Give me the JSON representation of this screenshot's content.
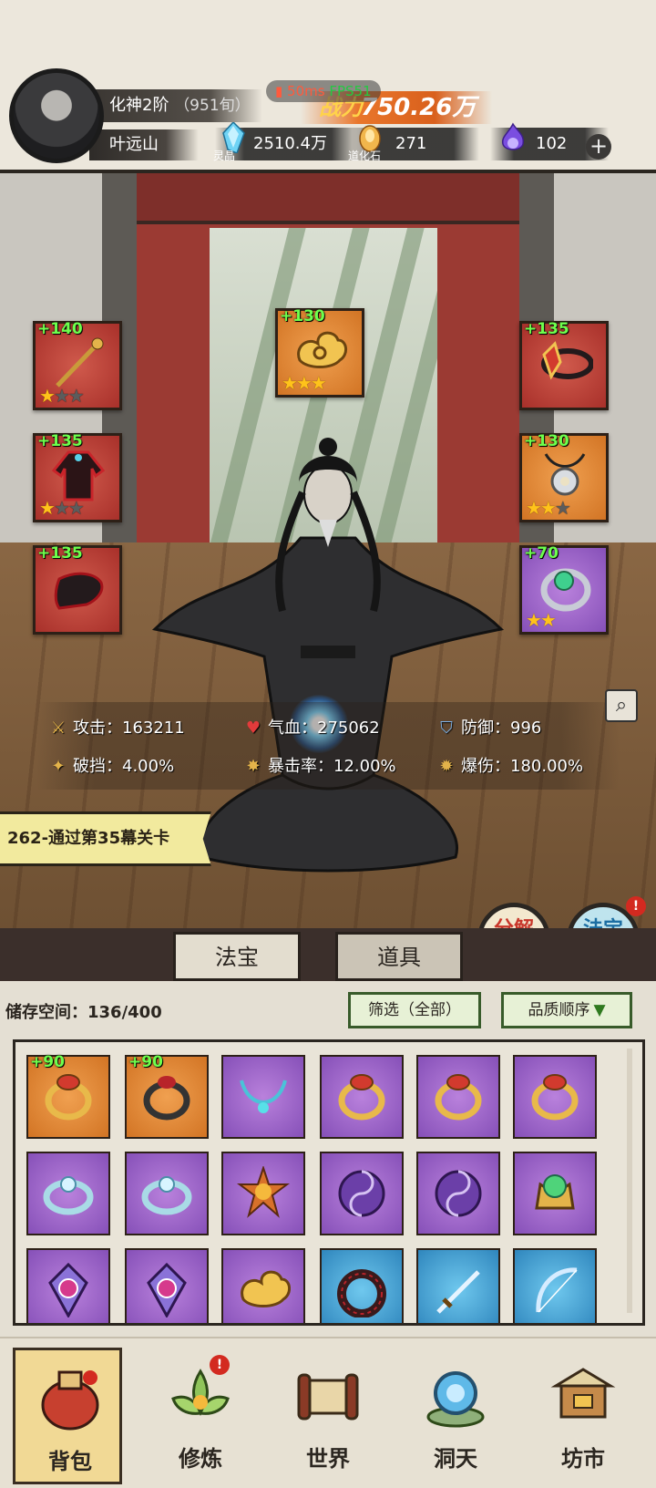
{
  "header": {
    "realm": "化神2阶",
    "realm_detail": "（951旬）",
    "player_name": "叶远山",
    "fps_ping": "50ms",
    "fps_label": "FPS51",
    "power_label": "战力",
    "power_value": "750.26万"
  },
  "currencies": [
    {
      "icon": "spirit-crystal-icon",
      "label": "灵晶",
      "value": "2510.4万"
    },
    {
      "icon": "daohua-stone-icon",
      "label": "道化石",
      "value": "271"
    },
    {
      "icon": "purple-flame-icon",
      "value": "102"
    }
  ],
  "equipped": [
    {
      "slot": "left-1",
      "level": "+140",
      "rarity": "red",
      "stars": 1,
      "icon": "staff-icon"
    },
    {
      "slot": "left-2",
      "level": "+135",
      "rarity": "red",
      "stars": 1,
      "icon": "robe-icon"
    },
    {
      "slot": "left-3",
      "level": "+135",
      "rarity": "red",
      "stars": 0,
      "icon": "boots-icon"
    },
    {
      "slot": "top",
      "level": "+130",
      "rarity": "orange",
      "stars": 3,
      "icon": "cloud-crown-icon"
    },
    {
      "slot": "right-1",
      "level": "+135",
      "rarity": "red",
      "stars": 0,
      "icon": "headband-icon"
    },
    {
      "slot": "right-2",
      "level": "+130",
      "rarity": "orange",
      "stars": 2,
      "icon": "pendant-icon"
    },
    {
      "slot": "right-3",
      "level": "+70",
      "rarity": "purple",
      "stars": 2,
      "icon": "jade-ring-icon"
    }
  ],
  "stats": {
    "attack_label": "攻击：",
    "attack_value": "163211",
    "hp_label": "气血：",
    "hp_value": "275062",
    "defense_label": "防御：",
    "defense_value": "996",
    "pierce_label": "破挡：",
    "pierce_value": "4.00%",
    "crit_label": "暴击率：",
    "crit_value": "12.00%",
    "critdmg_label": "爆伤：",
    "critdmg_value": "180.00%"
  },
  "quest": "262-通过第35幕关卡",
  "actions": {
    "decompose": "分解再造",
    "compose": "法宝合成",
    "compose_badge": "!"
  },
  "tabs": {
    "fabao": "法宝",
    "daoju": "道具"
  },
  "inventory": {
    "storage_label": "储存空间：",
    "storage_value": "136/400",
    "filter": "筛选（全部）",
    "sort": "品质顺序",
    "items": [
      {
        "rarity": "orange",
        "level": "+90",
        "icon": "gold-ring-icon"
      },
      {
        "rarity": "orange",
        "level": "+90",
        "icon": "dark-ring-icon"
      },
      {
        "rarity": "purple",
        "level": "",
        "icon": "necklace-icon"
      },
      {
        "rarity": "purple",
        "level": "",
        "icon": "gold-ring-icon"
      },
      {
        "rarity": "purple",
        "level": "",
        "icon": "gold-ring-icon"
      },
      {
        "rarity": "purple",
        "level": "",
        "icon": "gold-ring-icon"
      },
      {
        "rarity": "purple",
        "level": "",
        "icon": "silver-ring-icon"
      },
      {
        "rarity": "purple",
        "level": "",
        "icon": "silver-ring-icon"
      },
      {
        "rarity": "purple",
        "level": "",
        "icon": "sun-medallion-icon"
      },
      {
        "rarity": "purple",
        "level": "",
        "icon": "taiji-orb-icon"
      },
      {
        "rarity": "purple",
        "level": "",
        "icon": "taiji-orb-icon"
      },
      {
        "rarity": "purple",
        "level": "",
        "icon": "jade-crown-icon"
      },
      {
        "rarity": "purple",
        "level": "",
        "icon": "lotus-gem-icon"
      },
      {
        "rarity": "purple",
        "level": "",
        "icon": "lotus-gem-icon"
      },
      {
        "rarity": "purple",
        "level": "",
        "icon": "cloud-crown-icon"
      },
      {
        "rarity": "blue",
        "level": "",
        "icon": "dark-wreath-icon"
      },
      {
        "rarity": "blue",
        "level": "",
        "icon": "sword-icon"
      },
      {
        "rarity": "blue",
        "level": "",
        "icon": "bow-icon"
      }
    ]
  },
  "nav": [
    {
      "label": "背包",
      "icon": "backpack-icon"
    },
    {
      "label": "修炼",
      "icon": "lotus-icon",
      "badge": "!"
    },
    {
      "label": "世界",
      "icon": "scroll-map-icon"
    },
    {
      "label": "洞天",
      "icon": "portal-icon"
    },
    {
      "label": "坊市",
      "icon": "market-icon"
    }
  ],
  "colors": {
    "rarity_red": "#b8392f",
    "rarity_orange": "#e0842e",
    "rarity_purple": "#9a62c8",
    "rarity_blue": "#3c9fd2",
    "level_green": "#6dff4d",
    "star_gold": "#ffc31a"
  }
}
